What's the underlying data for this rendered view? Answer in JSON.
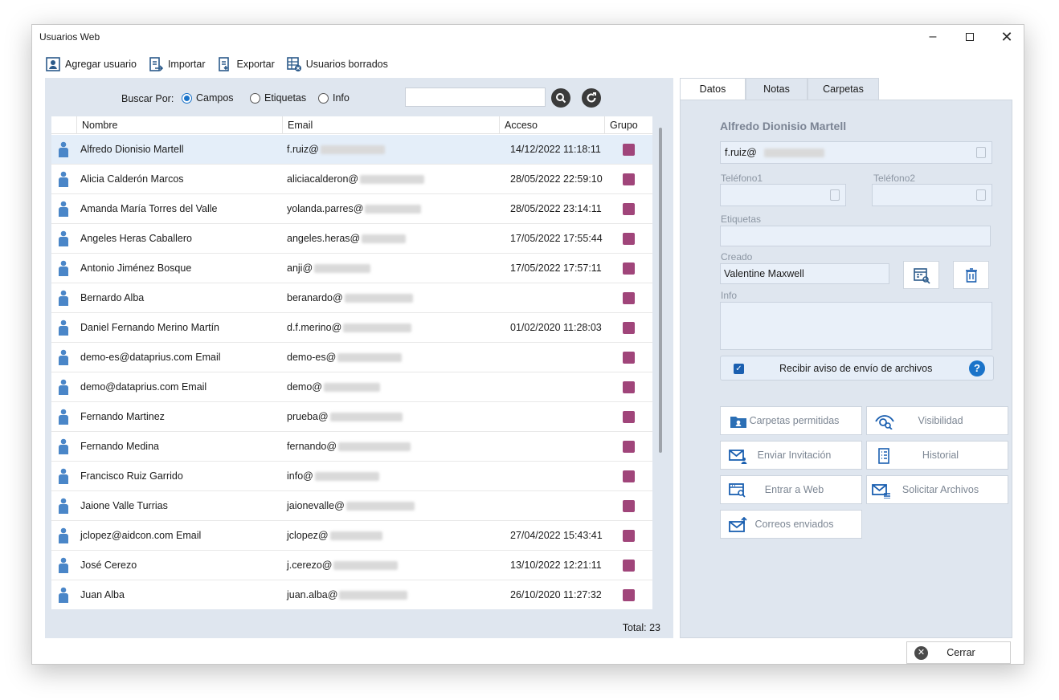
{
  "window": {
    "title": "Usuarios Web"
  },
  "toolbar": {
    "add_user": "Agregar usuario",
    "import": "Importar",
    "export": "Exportar",
    "deleted_users": "Usuarios borrados"
  },
  "search": {
    "label": "Buscar Por:",
    "options": [
      "Campos",
      "Etiquetas",
      "Info"
    ],
    "selected": "Campos",
    "value": ""
  },
  "grid": {
    "columns": [
      "Nombre",
      "Email",
      "Acceso",
      "Grupo"
    ],
    "rows": [
      {
        "name": "Alfredo Dionisio Martell",
        "email": "f.ruiz@",
        "access": "14/12/2022 11:18:11"
      },
      {
        "name": "Alicia Calderón Marcos",
        "email": "aliciacalderon@",
        "access": "28/05/2022 22:59:10"
      },
      {
        "name": "Amanda María Torres del Valle",
        "email": "yolanda.parres@",
        "access": "28/05/2022 23:14:11"
      },
      {
        "name": "Angeles Heras Caballero",
        "email": "angeles.heras@",
        "access": "17/05/2022 17:55:44"
      },
      {
        "name": "Antonio Jiménez Bosque",
        "email": "anji@",
        "access": "17/05/2022 17:57:11"
      },
      {
        "name": "Bernardo Alba",
        "email": "beranardo@",
        "access": ""
      },
      {
        "name": "Daniel Fernando Merino Martín",
        "email": "d.f.merino@",
        "access": "01/02/2020 11:28:03"
      },
      {
        "name": "demo-es@dataprius.com Email",
        "email": "demo-es@",
        "access": ""
      },
      {
        "name": "demo@dataprius.com Email",
        "email": "demo@",
        "access": ""
      },
      {
        "name": "Fernando Martinez",
        "email": "prueba@",
        "access": ""
      },
      {
        "name": "Fernando Medina",
        "email": "fernando@",
        "access": ""
      },
      {
        "name": "Francisco Ruiz Garrido",
        "email": "info@",
        "access": ""
      },
      {
        "name": "Jaione Valle Turrias",
        "email": "jaionevalle@",
        "access": ""
      },
      {
        "name": "jclopez@aidcon.com Email",
        "email": "jclopez@",
        "access": "27/04/2022 15:43:41"
      },
      {
        "name": "José Cerezo",
        "email": "j.cerezo@",
        "access": "13/10/2022 12:21:11"
      },
      {
        "name": "Juan Alba",
        "email": "juan.alba@",
        "access": "26/10/2020 11:27:32"
      }
    ],
    "total": "Total: 23"
  },
  "detail": {
    "tabs": [
      "Datos",
      "Notas",
      "Carpetas"
    ],
    "name": "Alfredo Dionisio Martell",
    "email": "f.ruiz@",
    "phone1_label": "Teléfono1",
    "phone2_label": "Teléfono2",
    "tags_label": "Etiquetas",
    "created_label": "Creado",
    "created_value": "Valentine Maxwell",
    "info_label": "Info",
    "notify_label": "Recibir aviso de envío de archivos",
    "buttons": {
      "allowed_folders": "Carpetas permitidas",
      "visibility": "Visibilidad",
      "send_invite": "Enviar Invitación",
      "history": "Historial",
      "enter_web": "Entrar a Web",
      "request_files": "Solicitar Archivos",
      "sent_emails": "Correos enviados"
    }
  },
  "footer": {
    "close": "Cerrar"
  },
  "colors": {
    "accent": "#1a73c9",
    "group": "#a0457a",
    "panel": "#dfe6ef",
    "selected_row": "#e4eef9"
  }
}
